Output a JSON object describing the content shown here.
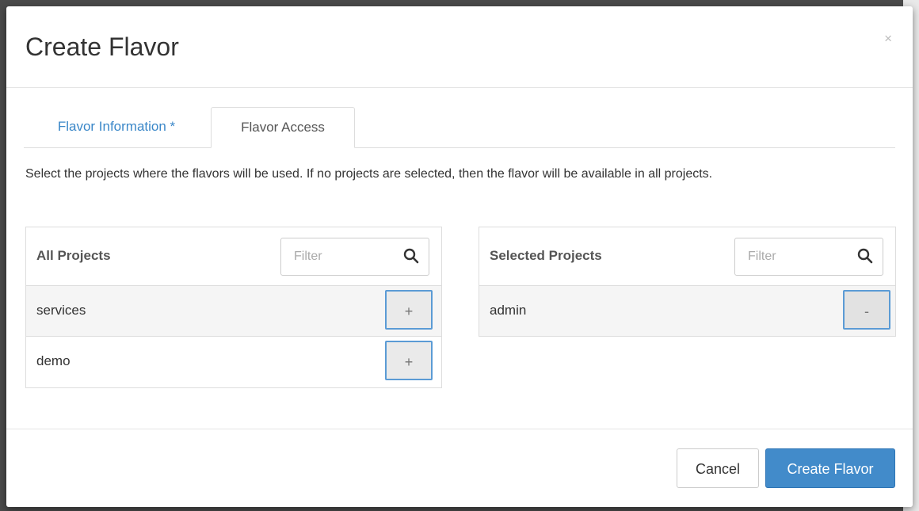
{
  "modal": {
    "title": "Create Flavor",
    "close_symbol": "×"
  },
  "tabs": [
    {
      "label": "Flavor Information *",
      "active": false
    },
    {
      "label": "Flavor Access",
      "active": true
    }
  ],
  "help_text": "Select the projects where the flavors will be used. If no projects are selected, then the flavor will be available in all projects.",
  "all_projects": {
    "title": "All Projects",
    "filter_placeholder": "Filter",
    "items": [
      {
        "name": "services",
        "action": "+"
      },
      {
        "name": "demo",
        "action": "+"
      }
    ]
  },
  "selected_projects": {
    "title": "Selected Projects",
    "filter_placeholder": "Filter",
    "items": [
      {
        "name": "admin",
        "action": "-"
      }
    ]
  },
  "footer": {
    "cancel_label": "Cancel",
    "submit_label": "Create Flavor"
  },
  "colors": {
    "primary": "#428bca",
    "link": "#3a87c8"
  },
  "icons": {
    "search": "search-icon",
    "close": "close-icon"
  }
}
